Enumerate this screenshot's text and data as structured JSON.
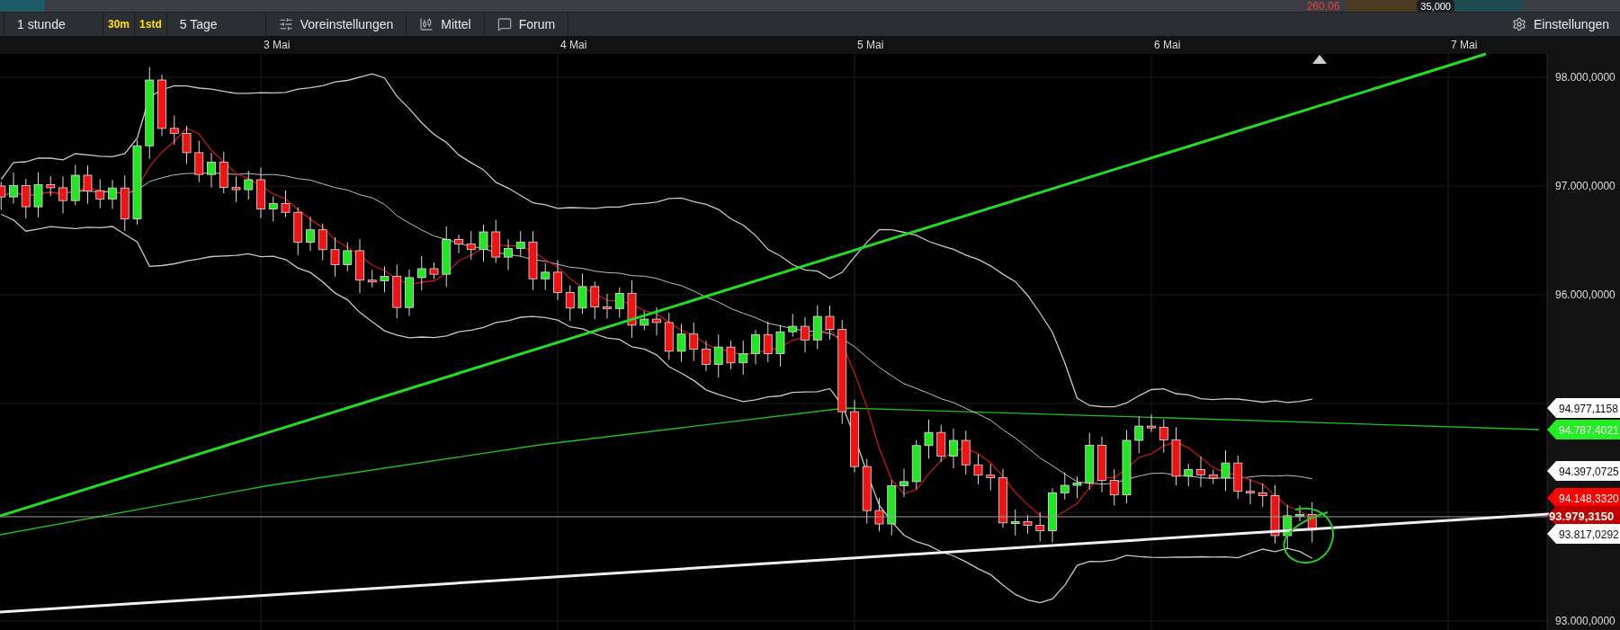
{
  "top_strip": {
    "value": "260,06",
    "badge": "35,000"
  },
  "toolbar": {
    "items": [
      {
        "label": "1 stunde",
        "kind": "plain"
      },
      {
        "label": "30m",
        "kind": "quick"
      },
      {
        "label": "1std",
        "kind": "quick"
      },
      {
        "label": "5 Tage",
        "kind": "plain"
      },
      {
        "label": "Voreinstellungen",
        "kind": "presets"
      },
      {
        "label": "Mittel",
        "kind": "indicators"
      },
      {
        "label": "Forum",
        "kind": "forum"
      }
    ],
    "settings": "Einstellungen"
  },
  "chart": {
    "date_labels": [
      "3 Mai",
      "4 Mai",
      "5 Mai",
      "6 Mai",
      "7 Mai"
    ],
    "price_labels": [
      "98.000,0000",
      "97.000,0000",
      "96.000,0000",
      "93.000,0000"
    ],
    "price_tags": [
      {
        "text": "94.977,1158",
        "kind": "tag",
        "color": "#ffffff"
      },
      {
        "text": "94.787,4021",
        "kind": "tag",
        "color": "#22ee22"
      },
      {
        "text": "94.397,0725",
        "kind": "tag",
        "color": "#ffffff"
      },
      {
        "text": "94.148,3320",
        "kind": "tag",
        "color": "#ff0000"
      },
      {
        "text": "93.979,3150",
        "kind": "current",
        "color": "#c00000"
      },
      {
        "text": "93.817,0292",
        "kind": "tag",
        "color": "#ffffff"
      }
    ]
  }
}
